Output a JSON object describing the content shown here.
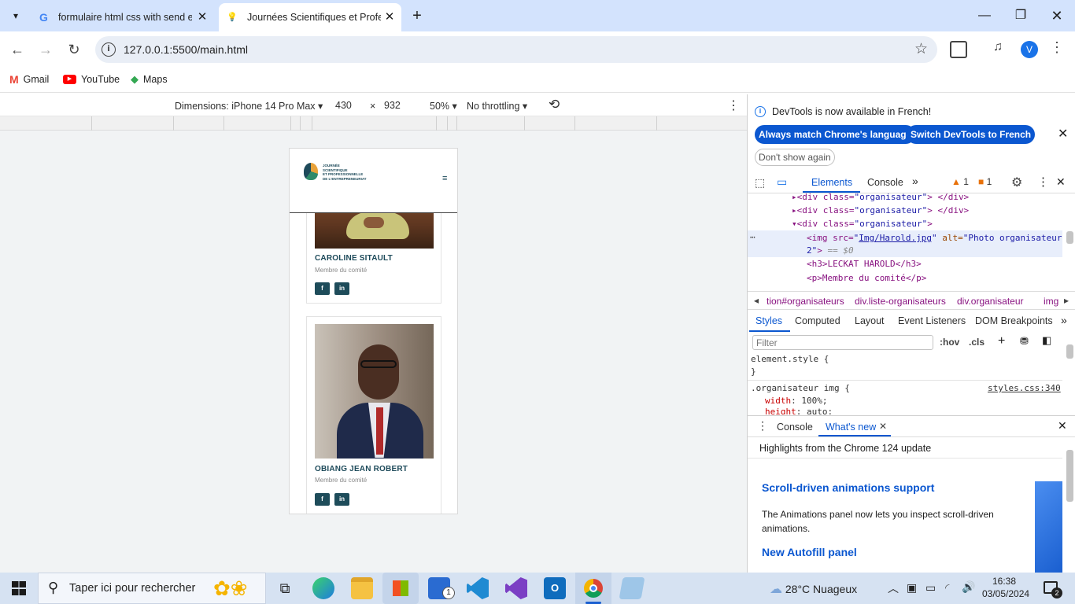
{
  "browser": {
    "tabs": [
      {
        "title": "formulaire html css with send e",
        "favicon": "google-g-icon"
      },
      {
        "title": "Journées Scientifiques et Profes",
        "favicon": "lightbulb-icon"
      }
    ],
    "url": "127.0.0.1:5500/main.html",
    "profile_initial": "V",
    "bookmarks": [
      "Gmail",
      "YouTube",
      "Maps"
    ]
  },
  "device_toolbar": {
    "dimensions_label": "Dimensions: iPhone 14 Pro Max",
    "width": "430",
    "times": "×",
    "height": "932",
    "zoom": "50%",
    "throttling": "No throttling"
  },
  "site": {
    "logo_lines": [
      "JOURNÉE",
      "SCIENTIFIQUE",
      "ET PROFESSIONNELLE",
      "DE L'ENTREPRENEURIAT"
    ],
    "menu_icon": "≡",
    "organisers": [
      {
        "name": "CAROLINE SITAULT",
        "role": "Membre du comité"
      },
      {
        "name": "OBIANG JEAN ROBERT",
        "role": "Membre du comité"
      }
    ],
    "social": {
      "facebook": "f",
      "linkedin": "in"
    }
  },
  "devtools": {
    "notice": "DevTools is now available in French!",
    "btn_match": "Always match Chrome's language",
    "btn_switch": "Switch DevTools to French",
    "btn_dont_show": "Don't show again",
    "main_tabs": [
      "Elements",
      "Console"
    ],
    "warn_count": "1",
    "issue_count": "1",
    "dom_lines": {
      "l1_tag": "<div class=",
      "l1_val": "\"organisateur\"",
      "l1_end": "> </div>",
      "l3_end": ">",
      "img_open": "<img src=",
      "img_src": "Img/Harold.jpg",
      "img_alt_attr": " alt=",
      "img_alt_val": "\"Photo organisateur",
      "img_alt_cont": "2\"",
      "img_eq": "== $0",
      "h3": "<h3>LECKAT HAROLD</h3>",
      "p": "<p>Membre du comité</p>"
    },
    "breadcrumbs": [
      "tion#organisateurs",
      "div.liste-organisateurs",
      "div.organisateur",
      "img"
    ],
    "style_tabs": [
      "Styles",
      "Computed",
      "Layout",
      "Event Listeners",
      "DOM Breakpoints"
    ],
    "filter_placeholder": "Filter",
    "hov": ":hov",
    "cls": ".cls",
    "element_style": "element.style {",
    "close_brace": "}",
    "rule_selector": ".organisateur img {",
    "rule_source": "styles.css:340",
    "prop_width": "width",
    "val_width": "100%;",
    "prop_height": "height",
    "val_height": "auto;",
    "drawer_tabs": [
      "Console",
      "What's new"
    ],
    "highlights": "Highlights from the Chrome 124 update",
    "article1_title": "Scroll-driven animations support",
    "article1_body": "The Animations panel now lets you inspect scroll-driven animations.",
    "article2_title": "New Autofill panel"
  },
  "taskbar": {
    "search_placeholder": "Taper ici pour rechercher",
    "weather": "28°C  Nuageux",
    "time": "16:38",
    "date": "03/05/2024",
    "notification_count": "2",
    "mail_badge": "1"
  },
  "colors": {
    "tabbar": "#d3e3fd",
    "accent_blue": "#0b57d0",
    "site_teal": "#1d4a5a"
  }
}
